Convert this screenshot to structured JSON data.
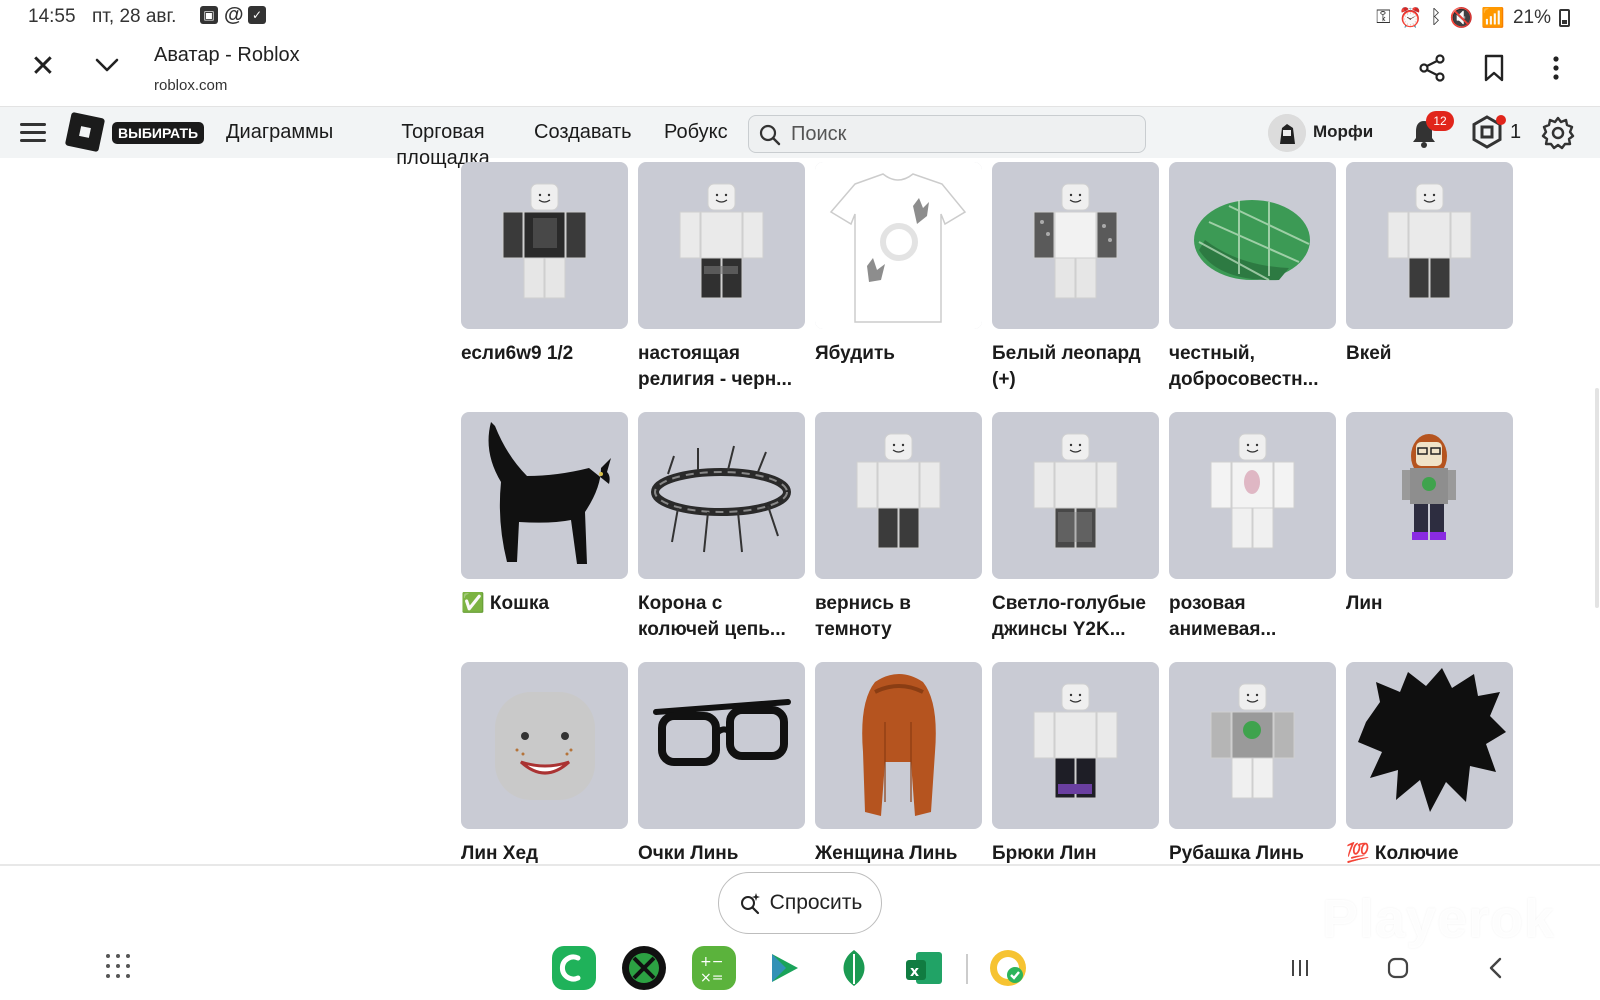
{
  "status_bar": {
    "time": "14:55",
    "date": "пт, 28 авг.",
    "battery": "21%"
  },
  "browser": {
    "title": "Аватар - Roblox",
    "url": "roblox.com"
  },
  "nav": {
    "select_badge": "ВЫБИРАТЬ",
    "charts": "Диаграммы",
    "marketplace": "Торговая площадка",
    "create": "Создавать",
    "robux": "Робукс",
    "search_placeholder": "Поиск",
    "username": "Морфи",
    "notifications_count": "12",
    "robux_count": "1"
  },
  "items": [
    {
      "name": "если6w9 1/2",
      "icon": "avatar-shirt-black"
    },
    {
      "name": "настоящая религия - черн...",
      "icon": "avatar-pants-black"
    },
    {
      "name": "Ябудить",
      "icon": "tshirt-hands"
    },
    {
      "name": "Белый леопард (+)",
      "icon": "avatar-leopard"
    },
    {
      "name": "честный, добросовестн...",
      "icon": "green-plaid-cap"
    },
    {
      "name": "Вкей",
      "icon": "avatar-pants-dark"
    },
    {
      "name": "✅ Кошка",
      "icon": "black-cat"
    },
    {
      "name": "Корона с колючей цепь...",
      "icon": "barbed-crown"
    },
    {
      "name": "вернись в темноту",
      "icon": "avatar-pants-dark"
    },
    {
      "name": "Светло-голубые джинсы Y2K...",
      "icon": "avatar-jeans"
    },
    {
      "name": "розовая анимевая...",
      "icon": "avatar-anime-shirt"
    },
    {
      "name": "Лин",
      "icon": "avatar-lin"
    },
    {
      "name": "Лин Хед",
      "icon": "head-smile"
    },
    {
      "name": "Очки Линь",
      "icon": "black-glasses"
    },
    {
      "name": "Женщина Линь",
      "icon": "brown-hair"
    },
    {
      "name": "Брюки Лин",
      "icon": "avatar-pants-purple"
    },
    {
      "name": "Рубашка Линь",
      "icon": "avatar-shirt-green"
    },
    {
      "name": "💯 Колючие",
      "icon": "black-spiky-hair"
    }
  ],
  "ask_button": "Спросить",
  "watermark": "Playerok",
  "colors": {
    "thumb_bg": "#c9cbd4",
    "nav_bg": "#f2f4f5",
    "badge_red": "#e1251b"
  }
}
